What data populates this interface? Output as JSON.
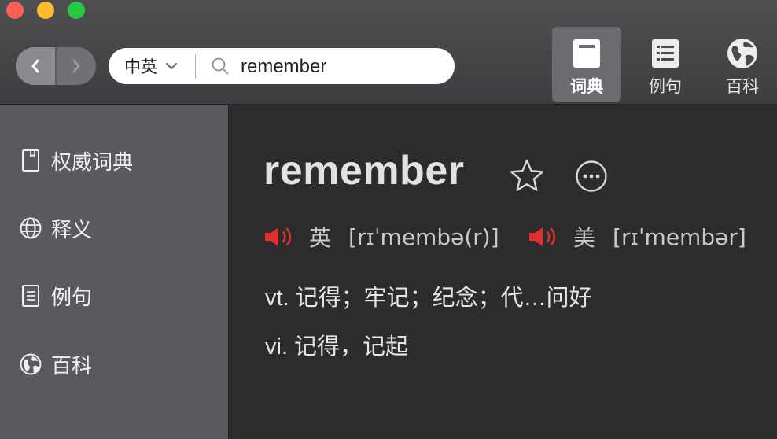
{
  "window": {
    "controls": [
      "close",
      "minimize",
      "maximize"
    ]
  },
  "toolbar": {
    "back_icon": "chevron-left-icon",
    "forward_icon": "chevron-right-icon",
    "search": {
      "language": "中英",
      "query": "remember"
    },
    "tabs": [
      {
        "label": "词典",
        "icon": "dictionary-book-icon",
        "active": true
      },
      {
        "label": "例句",
        "icon": "list-document-icon",
        "active": false
      },
      {
        "label": "百科",
        "icon": "globe-icon",
        "active": false
      }
    ]
  },
  "sidebar": {
    "items": [
      {
        "label": "权威词典",
        "icon": "book-icon"
      },
      {
        "label": "释义",
        "icon": "globe-outline-icon"
      },
      {
        "label": "例句",
        "icon": "document-icon"
      },
      {
        "label": "百科",
        "icon": "globe-icon"
      }
    ]
  },
  "entry": {
    "headword": "remember",
    "pronunciations": [
      {
        "region": "英",
        "ipa": "[rɪˈmembə(r)]"
      },
      {
        "region": "美",
        "ipa": "[rɪˈmembər]"
      }
    ],
    "definitions": [
      "vt. 记得；牢记；纪念；代…问好",
      "vi. 记得，记起"
    ]
  },
  "colors": {
    "speaker": "#e0302b",
    "toolbar": "#47474a",
    "sidebar": "#5a5a5e",
    "content": "#2c2c2e"
  }
}
